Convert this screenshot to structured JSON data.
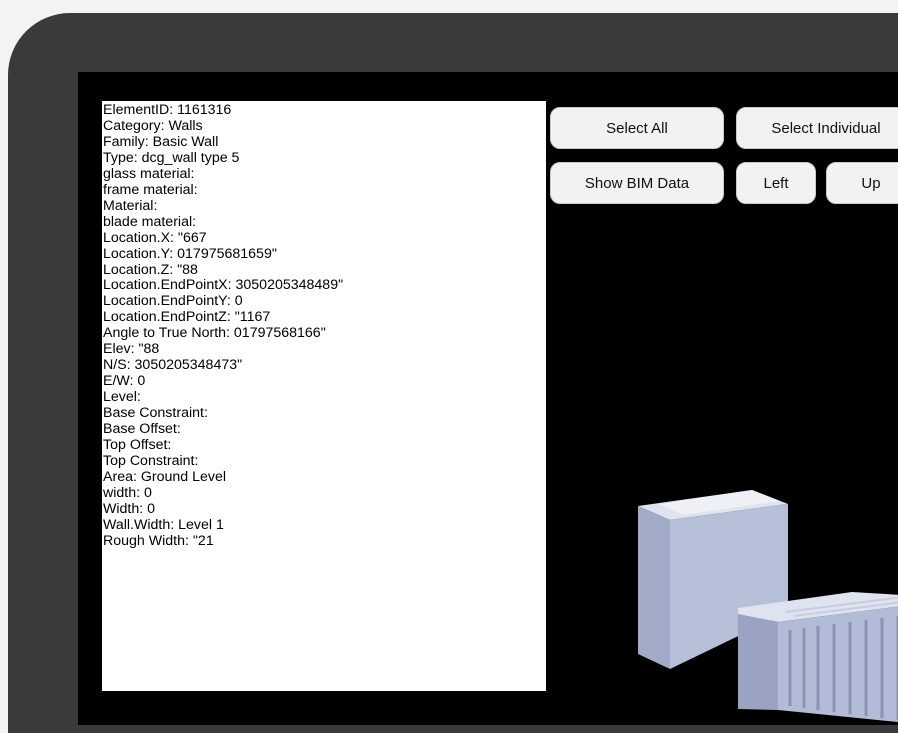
{
  "buttons": {
    "select_all": "Select All",
    "select_individual": "Select Individual",
    "show_bim_data": "Show BIM Data",
    "left": "Left",
    "up": "Up"
  },
  "info_lines": [
    "ElementID: 1161316",
    "Category: Walls",
    "Family: Basic Wall",
    "Type: dcg_wall type 5",
    "glass material:",
    "frame material:",
    "Material:",
    "blade material:",
    "Location.X: \"667",
    "Location.Y: 017975681659\"",
    "Location.Z: \"88",
    "Location.EndPointX: 3050205348489\"",
    "Location.EndPointY: 0",
    "Location.EndPointZ: \"1167",
    "Angle to True North: 01797568166\"",
    "Elev: \"88",
    "N/S: 3050205348473\"",
    "E/W: 0",
    "Level:",
    "Base Constraint:",
    "Base Offset:",
    "Top Offset:",
    "Top Constraint:",
    "Area: Ground Level",
    "width: 0",
    "Width: 0",
    "Wall.Width: Level 1",
    "Rough Width: \"21"
  ],
  "colors": {
    "device_frame": "#3a3a3a",
    "screen_bg": "#000000",
    "model_light": "#dfe3ef",
    "model_mid": "#a9b3cf",
    "model_dark": "#8791b1"
  },
  "icons": {
    "model": "3d-building-model"
  }
}
